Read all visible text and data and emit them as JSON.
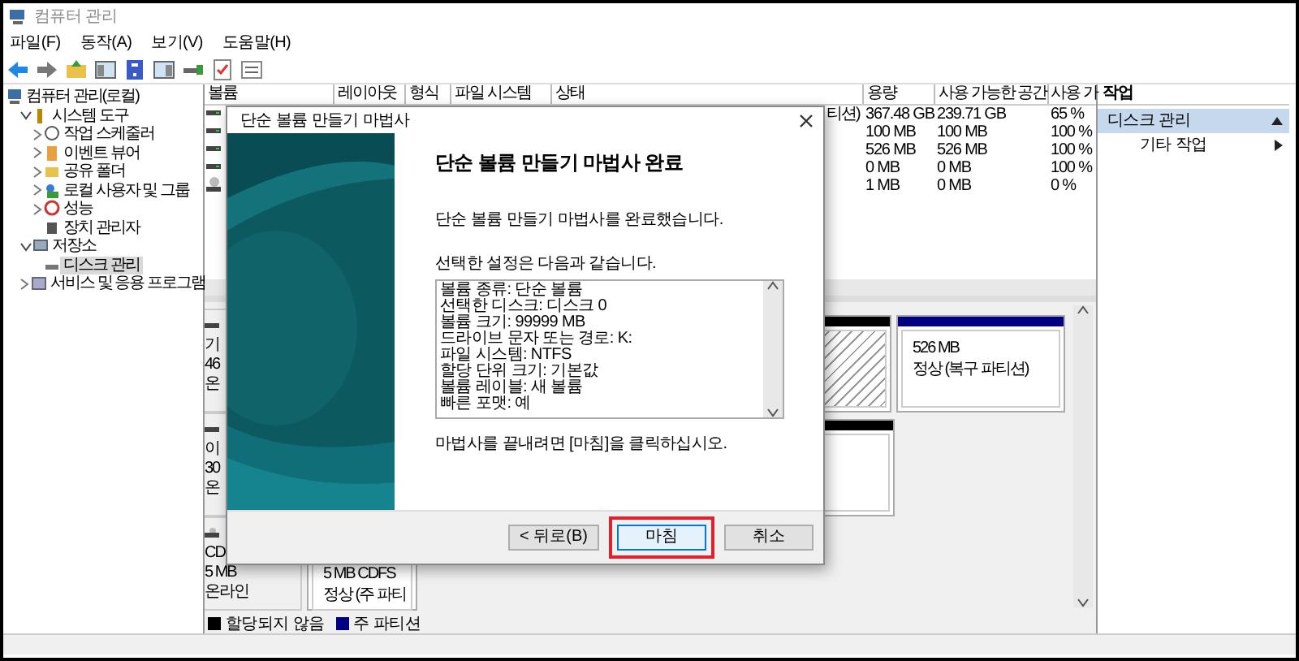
{
  "window": {
    "title": "컴퓨터 관리"
  },
  "menu": [
    {
      "label": "파일(F)"
    },
    {
      "label": "동작(A)"
    },
    {
      "label": "보기(V)"
    },
    {
      "label": "도움말(H)"
    }
  ],
  "tree": [
    {
      "label": "컴퓨터 관리(로컬)",
      "selected": false,
      "children": [
        {
          "label": "시스템 도구",
          "expanded": true,
          "selected": false,
          "children": [
            {
              "label": "작업 스케줄러",
              "expanded": false,
              "selected": false
            },
            {
              "label": "이벤트 뷰어",
              "expanded": false,
              "selected": false
            },
            {
              "label": "공유 폴더",
              "expanded": false,
              "selected": false
            },
            {
              "label": "로컬 사용자 및 그룹",
              "expanded": false,
              "selected": false
            },
            {
              "label": "성능",
              "expanded": false,
              "selected": false
            },
            {
              "label": "장치 관리자",
              "selected": false
            }
          ]
        },
        {
          "label": "저장소",
          "expanded": true,
          "selected": false,
          "children": [
            {
              "label": "디스크 관리",
              "selected": true
            }
          ]
        },
        {
          "label": "서비스 및 응용 프로그램",
          "expanded": false,
          "selected": false
        }
      ]
    }
  ],
  "volume_table": {
    "columns": [
      "볼륨",
      "레이아웃",
      "형식",
      "파일 시스템",
      "상태",
      "용량",
      "사용 가능한 공간",
      "사용 가"
    ],
    "rows": [
      {
        "kind": "disk",
        "status": "티션)",
        "capacity": "367.48 GB",
        "free_space": "239.71 GB",
        "percent_free": "65 %"
      },
      {
        "kind": "disk",
        "capacity": "100 MB",
        "free_space": "100 MB",
        "percent_free": "100 %"
      },
      {
        "kind": "disk",
        "capacity": "526 MB",
        "free_space": "526 MB",
        "percent_free": "100 %"
      },
      {
        "kind": "disk",
        "capacity": "0 MB",
        "free_space": "0 MB",
        "percent_free": "100 %"
      },
      {
        "kind": "cd",
        "capacity": "1 MB",
        "free_space": "0 MB",
        "percent_free": "0 %"
      }
    ]
  },
  "disks": [
    {
      "kind": "disk",
      "label_lines": [
        "기",
        "46",
        "온"
      ],
      "partitions": [
        {
          "kind": "unallocated",
          "selected": true
        },
        {
          "kind": "primary",
          "selected": false,
          "lines": [
            "526 MB",
            "정상 (복구 파티션)"
          ]
        }
      ]
    },
    {
      "kind": "disk",
      "label_lines": [
        "이",
        "30",
        "온"
      ],
      "partitions": [
        {
          "kind": "unallocated",
          "selected": false
        }
      ]
    },
    {
      "kind": "cd",
      "label_lines": [
        "CD",
        "5 MB",
        "온라인"
      ],
      "partitions": [
        {
          "kind": "primary",
          "selected": false,
          "lines": [
            "5 MB CDFS",
            "정상 (주 파티"
          ]
        }
      ]
    }
  ],
  "legend": [
    {
      "label": "할당되지 않음",
      "color": "#000000"
    },
    {
      "label": "주 파티션",
      "color": "#000080"
    }
  ],
  "actions": {
    "header": "작업",
    "sections": [
      {
        "label": "디스크 관리",
        "items": [
          {
            "label": "기타 작업"
          }
        ]
      }
    ]
  },
  "dialog": {
    "title": "단순 볼륨 만들기 마법사",
    "heading": "단순 볼륨 만들기 마법사 완료",
    "intro": "단순 볼륨 만들기 마법사를 완료했습니다.",
    "settings_label": "선택한 설정은 다음과 같습니다.",
    "settings": [
      "볼륨 종류: 단순 볼륨",
      "선택한 디스크: 디스크 0",
      "볼륨 크기: 99999 MB",
      "드라이브 문자 또는 경로: K:",
      "파일 시스템: NTFS",
      "할당 단위 크기: 기본값",
      "볼륨 레이블: 새 볼륨",
      "빠른 포맷: 예"
    ],
    "outro": "마법사를 끝내려면 [마침]을 클릭하십시오.",
    "buttons": [
      {
        "label": "< 뒤로(B)",
        "default": false,
        "highlighted": false
      },
      {
        "label": "마침",
        "default": true,
        "highlighted": true
      },
      {
        "label": "취소",
        "default": false,
        "highlighted": false
      }
    ]
  }
}
